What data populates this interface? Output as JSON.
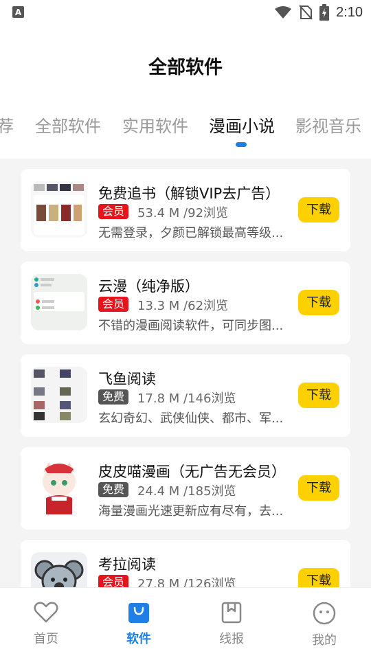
{
  "status_bar": {
    "time": "2:10",
    "app_badge": "A"
  },
  "header": {
    "title": "全部软件"
  },
  "tabs": [
    {
      "label": "荐",
      "active": false
    },
    {
      "label": "全部软件",
      "active": false
    },
    {
      "label": "实用软件",
      "active": false
    },
    {
      "label": "漫画小说",
      "active": true
    },
    {
      "label": "影视音乐",
      "active": false
    }
  ],
  "apps": [
    {
      "title": "免费追书（解锁VIP去广告）",
      "tag": "会员",
      "tag_type": "vip",
      "meta": "53.4 M /92浏览",
      "desc": "无需登录，夕颜已解锁最高等级...",
      "button": "下载"
    },
    {
      "title": "云漫（纯净版）",
      "tag": "会员",
      "tag_type": "vip",
      "meta": "13.3 M /62浏览",
      "desc": "不错的漫画阅读软件，可同步图...",
      "button": "下载"
    },
    {
      "title": "飞鱼阅读",
      "tag": "免费",
      "tag_type": "free",
      "meta": "17.8 M /146浏览",
      "desc": "玄幻奇幻、武侠仙侠、都市、军...",
      "button": "下载"
    },
    {
      "title": "皮皮喵漫画（无广告无会员）",
      "tag": "免费",
      "tag_type": "free",
      "meta": "24.4 M /185浏览",
      "desc": "海量漫画光速更新应有尽有，去...",
      "button": "下载"
    },
    {
      "title": "考拉阅读",
      "tag": "会员",
      "tag_type": "vip",
      "meta": "27.8 M /126浏览",
      "desc": "",
      "button": "下载"
    }
  ],
  "bottom_nav": [
    {
      "label": "首页",
      "icon": "heart-icon",
      "active": false
    },
    {
      "label": "软件",
      "icon": "bag-icon",
      "active": true
    },
    {
      "label": "线报",
      "icon": "bookmark-icon",
      "active": false
    },
    {
      "label": "我的",
      "icon": "smiley-icon",
      "active": false
    }
  ],
  "colors": {
    "accent": "#1e7fe6",
    "vip_tag": "#e8141c",
    "free_tag": "#555555",
    "download_button": "#fdd000"
  }
}
